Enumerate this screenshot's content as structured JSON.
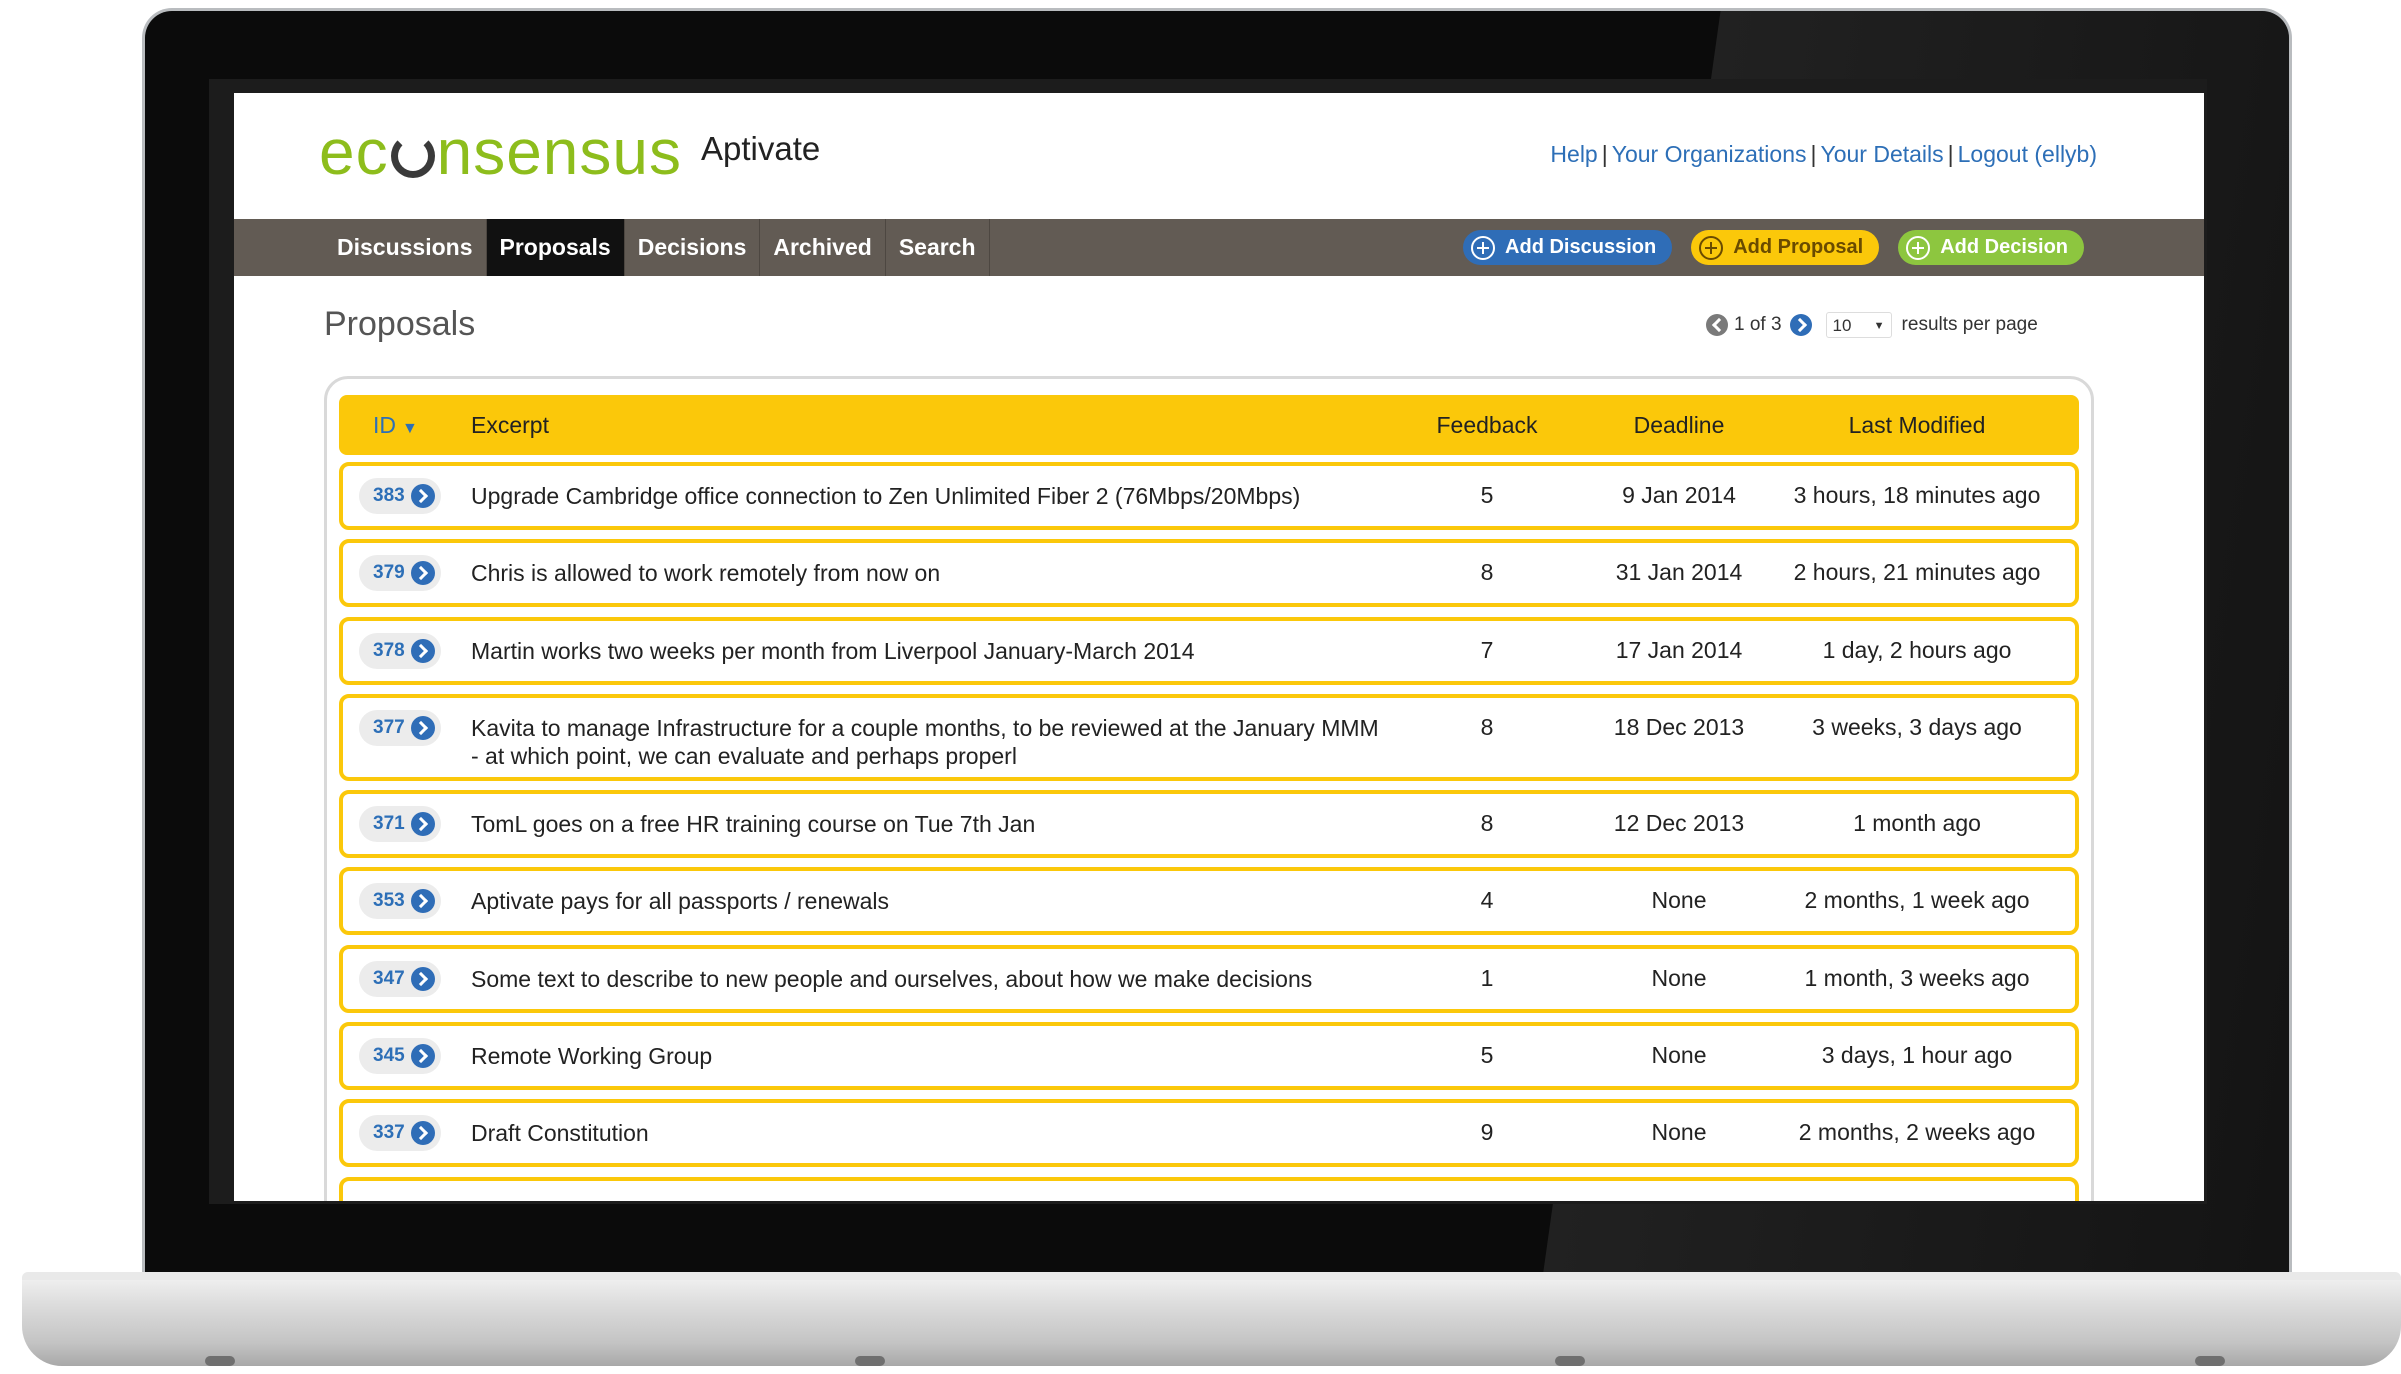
{
  "header": {
    "logo_text_left": "ec",
    "logo_text_right": "nsensus",
    "org_name": "Aptivate",
    "links": [
      "Help",
      "Your Organizations",
      "Your Details",
      "Logout (ellyb)"
    ],
    "separator": "|"
  },
  "nav": {
    "tabs": [
      "Discussions",
      "Proposals",
      "Decisions",
      "Archived",
      "Search"
    ],
    "active_tab": "Proposals",
    "actions": [
      "Add Discussion",
      "Add Proposal",
      "Add Decision"
    ]
  },
  "page": {
    "title": "Proposals",
    "pager_text": "1 of 3",
    "per_page_value": "10",
    "per_page_label": "results per page"
  },
  "table": {
    "columns": {
      "id": "ID",
      "excerpt": "Excerpt",
      "feedback": "Feedback",
      "deadline": "Deadline",
      "last_modified": "Last Modified"
    },
    "sort_indicator": "▼",
    "rows": [
      {
        "id": "383",
        "excerpt": "Upgrade Cambridge office connection to Zen Unlimited Fiber 2 (76Mbps/20Mbps)",
        "feedback": "5",
        "deadline": "9 Jan 2014",
        "last_modified": "3 hours, 18 minutes ago"
      },
      {
        "id": "379",
        "excerpt": "Chris is allowed to work remotely from now on",
        "feedback": "8",
        "deadline": "31 Jan 2014",
        "last_modified": "2 hours, 21 minutes ago"
      },
      {
        "id": "378",
        "excerpt": "Martin works two weeks per month from Liverpool January-March 2014",
        "feedback": "7",
        "deadline": "17 Jan 2014",
        "last_modified": "1 day, 2 hours ago"
      },
      {
        "id": "377",
        "excerpt": "Kavita to manage Infrastructure for a couple months, to be reviewed at the January MMM - at which point, we can evaluate and perhaps properl",
        "feedback": "8",
        "deadline": "18 Dec 2013",
        "last_modified": "3 weeks, 3 days ago"
      },
      {
        "id": "371",
        "excerpt": "TomL goes on a free HR training course on Tue 7th Jan",
        "feedback": "8",
        "deadline": "12 Dec 2013",
        "last_modified": "1 month ago"
      },
      {
        "id": "353",
        "excerpt": "Aptivate pays for all passports / renewals",
        "feedback": "4",
        "deadline": "None",
        "last_modified": "2 months, 1 week ago"
      },
      {
        "id": "347",
        "excerpt": "Some text to describe to new people and ourselves, about how we make decisions",
        "feedback": "1",
        "deadline": "None",
        "last_modified": "1 month, 3 weeks ago"
      },
      {
        "id": "345",
        "excerpt": "Remote Working Group",
        "feedback": "5",
        "deadline": "None",
        "last_modified": "3 days, 1 hour ago"
      },
      {
        "id": "337",
        "excerpt": "Draft Constitution",
        "feedback": "9",
        "deadline": "None",
        "last_modified": "2 months, 2 weeks ago"
      }
    ]
  },
  "colors": {
    "brand_green": "#8dbd1c",
    "nav_bg": "#625b54",
    "table_yellow": "#fbc80a",
    "link_blue": "#2d6fb7"
  }
}
